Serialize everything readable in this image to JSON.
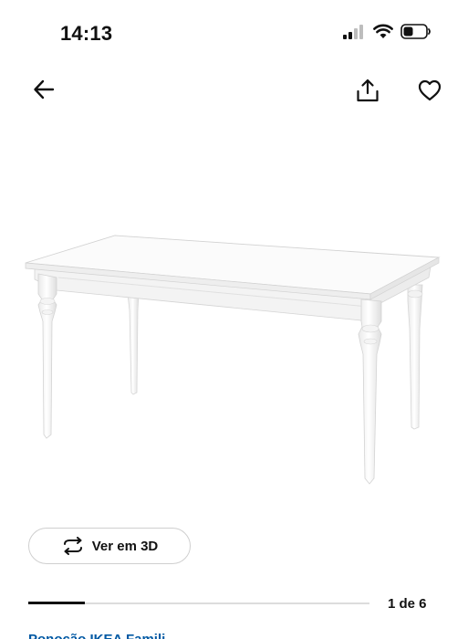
{
  "status_bar": {
    "time": "14:13",
    "icons": [
      "cellular-signal-icon",
      "wifi-icon",
      "battery-icon"
    ]
  },
  "nav": {
    "back_icon": "arrow-left-icon",
    "share_icon": "share-icon",
    "favourite_icon": "heart-icon"
  },
  "product": {
    "image": "white-dining-table-with-turned-legs"
  },
  "view_3d": {
    "icon": "rotate-3d-icon",
    "label": "Ver em 3D"
  },
  "carousel": {
    "counter": "1 de 6",
    "current": 1,
    "total": 6
  },
  "seller": {
    "text": "Ponoção IKEA Famili..."
  },
  "colors": {
    "accent_link": "#0058a3",
    "text": "#111111",
    "track": "#dcdcdc"
  }
}
